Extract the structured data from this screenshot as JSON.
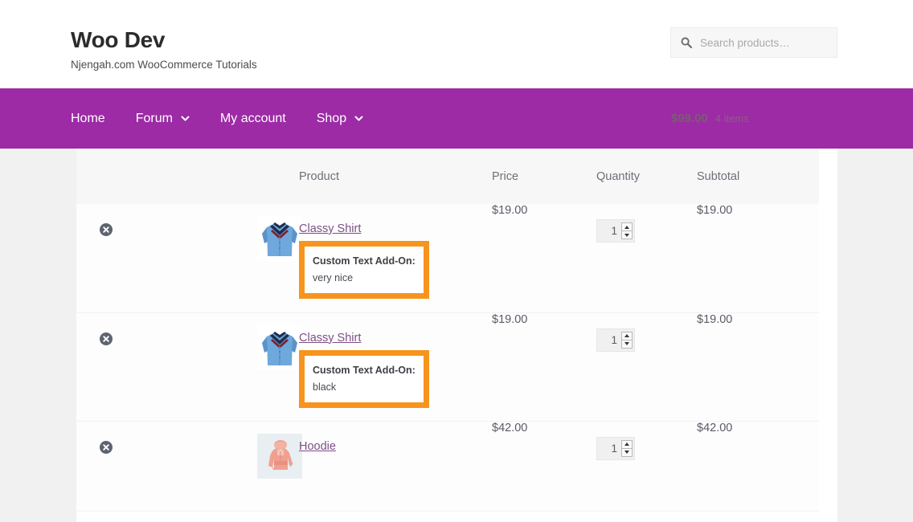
{
  "header": {
    "brand_title": "Woo Dev",
    "brand_tagline": "Njengah.com WooCommerce Tutorials",
    "search": {
      "icon": "search-icon",
      "placeholder": "Search products…",
      "value": ""
    }
  },
  "nav": {
    "items": [
      {
        "label": "Home",
        "has_caret": false
      },
      {
        "label": "Forum",
        "has_caret": true
      },
      {
        "label": "My account",
        "has_caret": false
      },
      {
        "label": "Shop",
        "has_caret": true
      }
    ],
    "cart": {
      "amount": "$99.00",
      "count": "4 items",
      "icon": "shopping-basket-icon"
    }
  },
  "cart_table": {
    "columns": [
      "",
      "",
      "Product",
      "Price",
      "Quantity",
      "Subtotal"
    ],
    "headers": {
      "product": "Product",
      "price": "Price",
      "quantity": "Quantity",
      "subtotal": "Subtotal"
    },
    "rows": [
      {
        "remove_icon": "remove-item-icon",
        "thumb": "classy-shirt-thumbnail",
        "name": "Classy Shirt",
        "addon_label": "Custom Text Add-On:",
        "addon_value": "very nice",
        "price": "$19.00",
        "quantity": "1",
        "subtotal": "$19.00"
      },
      {
        "remove_icon": "remove-item-icon",
        "thumb": "classy-shirt-thumbnail",
        "name": "Classy Shirt",
        "addon_label": "Custom Text Add-On:",
        "addon_value": "black",
        "price": "$19.00",
        "quantity": "1",
        "subtotal": "$19.00"
      },
      {
        "remove_icon": "remove-item-icon",
        "thumb": "hoodie-thumbnail",
        "name": "Hoodie",
        "addon_label": "",
        "addon_value": "",
        "price": "$42.00",
        "quantity": "1",
        "subtotal": "$42.00"
      }
    ]
  },
  "colors": {
    "nav_purple": "#9c2ba5",
    "highlight_orange": "#f7941d",
    "link_purple": "#7d4f86",
    "page_bg": "#f1f1f1"
  }
}
